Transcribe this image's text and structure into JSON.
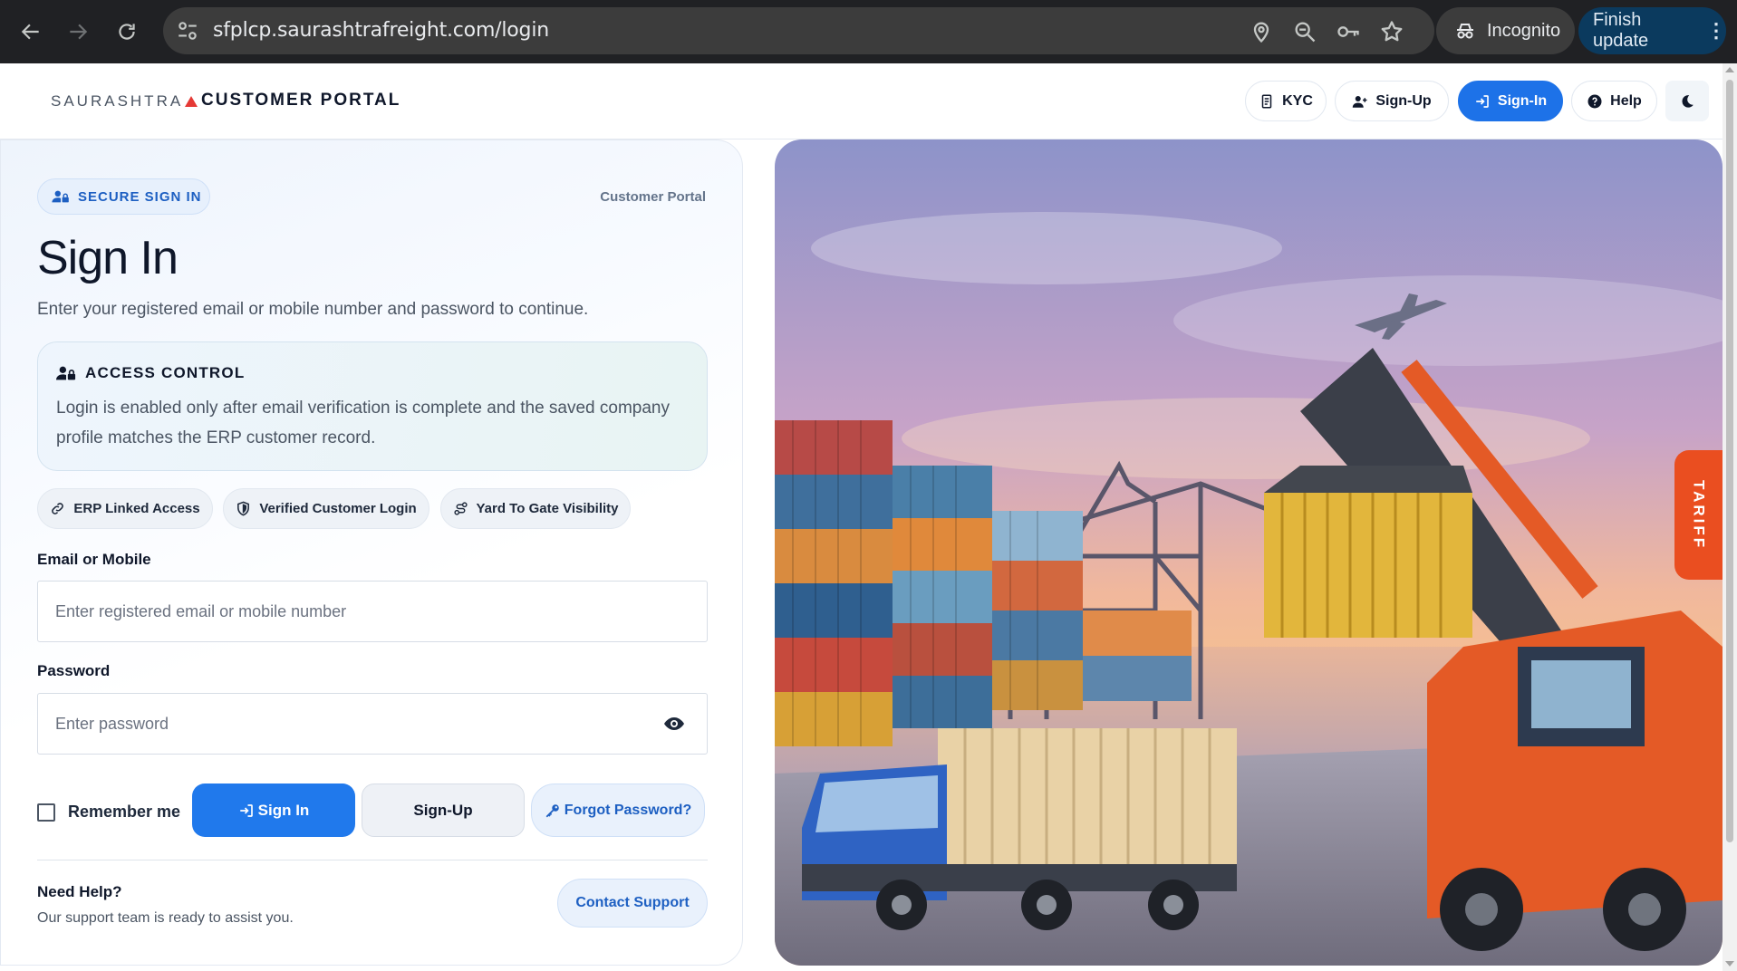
{
  "browser": {
    "url": "sfplcp.saurashtrafreight.com/login",
    "incognito_label": "Incognito",
    "update_label": "Finish update",
    "menu_glyph": "⋮"
  },
  "header": {
    "logo_text": "SAURASHTRA",
    "portal_title": "CUSTOMER PORTAL",
    "kyc_label": "KYC",
    "signup_label": "Sign-Up",
    "signin_label": "Sign-In",
    "help_label": "Help",
    "accent_color": "#1d72e8"
  },
  "form": {
    "secure_badge": "SECURE SIGN IN",
    "portal_label": "Customer Portal",
    "title": "Sign In",
    "subtitle": "Enter your registered email or mobile number and password to continue.",
    "access_title": "ACCESS CONTROL",
    "access_text": "Login is enabled only after email verification is complete and the saved company profile matches the ERP customer record.",
    "chips": [
      "ERP Linked Access",
      "Verified Customer Login",
      "Yard To Gate Visibility"
    ],
    "email_label": "Email or Mobile",
    "email_placeholder": "Enter registered email or mobile number",
    "password_label": "Password",
    "password_placeholder": "Enter password",
    "remember_label": "Remember me",
    "remember_checked": false,
    "signin_button": "Sign In",
    "signup_button": "Sign-Up",
    "forgot_button": "Forgot Password?",
    "help_title": "Need Help?",
    "help_text": "Our support team is ready to assist you.",
    "contact_button": "Contact Support"
  },
  "side_tab": {
    "label": "TARIFF",
    "color": "#ea4e20"
  }
}
